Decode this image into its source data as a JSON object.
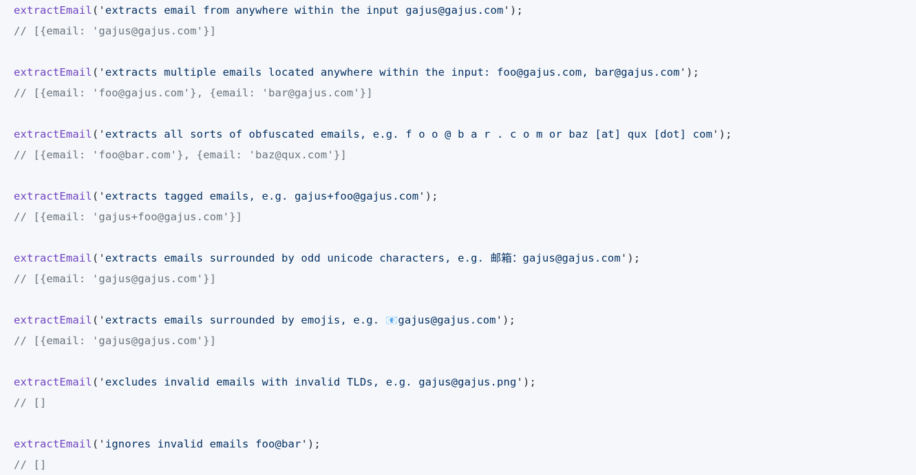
{
  "editor": {
    "language": "javascript",
    "background_color": "#f5f7fa",
    "colors": {
      "function": "#6f42c1",
      "punctuation": "#24292e",
      "string": "#032f62",
      "comment": "#6a737d"
    },
    "function_name": "extractEmail",
    "blocks": [
      {
        "id": "block-1",
        "call": {
          "fn": "extractEmail",
          "open": "('",
          "arg": "extracts email from anywhere within the input gajus@gajus.com",
          "close": "');"
        },
        "result_comment": "// [{email: 'gajus@gajus.com'}]"
      },
      {
        "id": "block-2",
        "call": {
          "fn": "extractEmail",
          "open": "('",
          "arg": "extracts multiple emails located anywhere within the input: foo@gajus.com, bar@gajus.com",
          "close": "');"
        },
        "result_comment": "// [{email: 'foo@gajus.com'}, {email: 'bar@gajus.com'}]"
      },
      {
        "id": "block-3",
        "call": {
          "fn": "extractEmail",
          "open": "('",
          "arg": "extracts all sorts of obfuscated emails, e.g. f o o @ b a r . c o m or baz [at] qux [dot] com",
          "close": "');"
        },
        "result_comment": "// [{email: 'foo@bar.com'}, {email: 'baz@qux.com'}]"
      },
      {
        "id": "block-4",
        "call": {
          "fn": "extractEmail",
          "open": "('",
          "arg": "extracts tagged emails, e.g. gajus+foo@gajus.com",
          "close": "');"
        },
        "result_comment": "// [{email: 'gajus+foo@gajus.com'}]"
      },
      {
        "id": "block-5",
        "call": {
          "fn": "extractEmail",
          "open": "('",
          "arg_pre": "extracts emails surrounded by odd unicode characters, e.g. ",
          "arg_special": "邮箱：",
          "arg_post": "gajus@gajus.com",
          "close": "');"
        },
        "result_comment": "// [{email: 'gajus@gajus.com'}]"
      },
      {
        "id": "block-6",
        "call": {
          "fn": "extractEmail",
          "open": "('",
          "arg_pre": "extracts emails surrounded by emojis, e.g. ",
          "arg_special": "📧",
          "arg_post": "gajus@gajus.com",
          "close": "');"
        },
        "result_comment": "// [{email: 'gajus@gajus.com'}]"
      },
      {
        "id": "block-7",
        "call": {
          "fn": "extractEmail",
          "open": "('",
          "arg": "excludes invalid emails with invalid TLDs, e.g. gajus@gajus.png",
          "close": "');"
        },
        "result_comment": "// []"
      },
      {
        "id": "block-8",
        "call": {
          "fn": "extractEmail",
          "open": "('",
          "arg": "ignores invalid emails foo@bar",
          "close": "');"
        },
        "result_comment": "// []"
      }
    ]
  }
}
